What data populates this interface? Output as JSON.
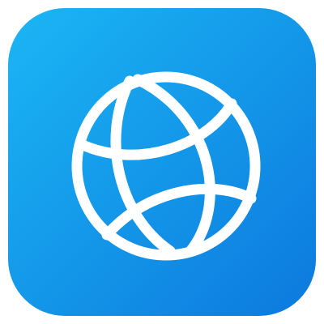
{
  "app_icon": {
    "icon": "globe-icon",
    "colors": {
      "gradient_top_left": "#1bb6f4",
      "gradient_bottom_right": "#0c79de",
      "glyph": "#ffffff",
      "page_background": "#ffffff"
    }
  }
}
